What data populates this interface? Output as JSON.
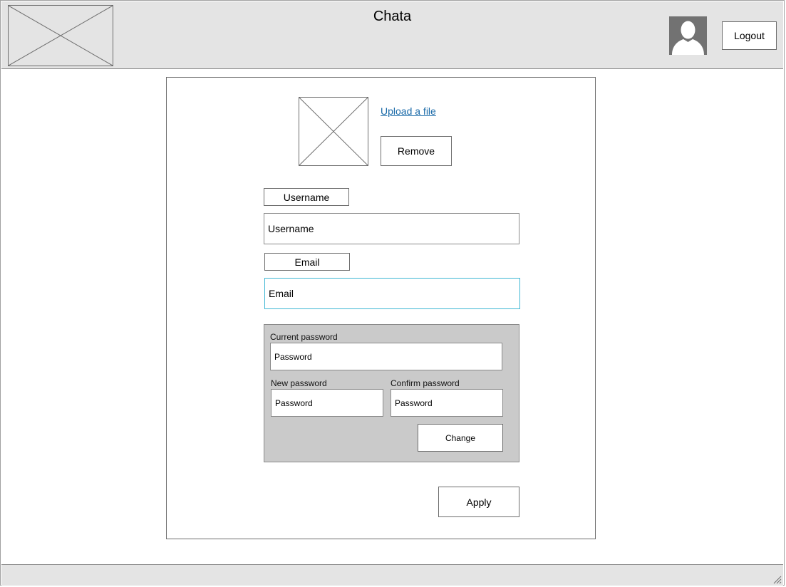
{
  "header": {
    "title": "Chata",
    "logout_label": "Logout"
  },
  "profile": {
    "upload_link": "Upload a file",
    "remove_label": "Remove"
  },
  "form": {
    "username_label": "Username",
    "username_placeholder": "Username",
    "email_label": "Email",
    "email_placeholder": "Email",
    "apply_label": "Apply"
  },
  "password": {
    "current_label": "Current password",
    "current_placeholder": "Password",
    "new_label": "New password",
    "new_placeholder": "Password",
    "confirm_label": "Confirm password",
    "confirm_placeholder": "Password",
    "change_label": "Change"
  },
  "colors": {
    "header_bg": "#e4e4e4",
    "link": "#1a6aa8",
    "focus_border": "#3fb7d4",
    "password_panel_bg": "#cacaca"
  },
  "icons": {
    "logo": "image-placeholder-icon",
    "avatar": "user-avatar-icon",
    "profile_picture": "image-placeholder-icon",
    "resize": "resize-grip-icon"
  }
}
